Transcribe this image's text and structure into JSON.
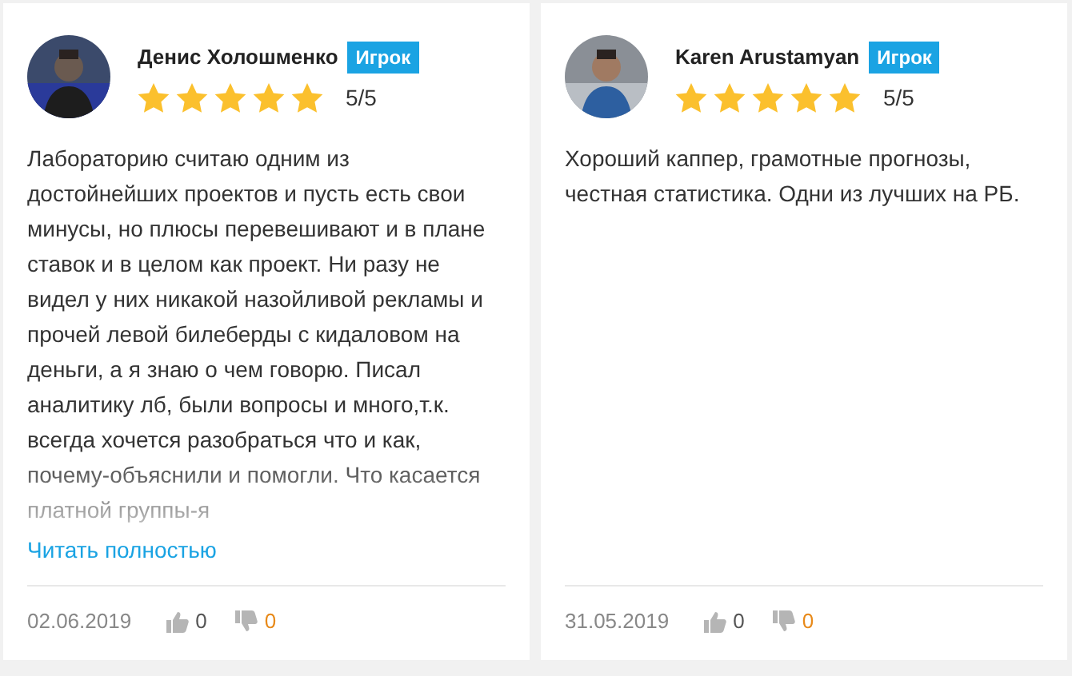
{
  "reviews": [
    {
      "author": "Денис Холошменко",
      "badge": "Игрок",
      "stars": 5,
      "score": "5/5",
      "text": "Лабораторию считаю одним из достойнейших проектов и пусть есть свои минусы, но плюсы перевешивают и в плане ставок и в целом как проект. Ни разу не видел у них никакой назойливой рекламы и прочей левой билеберды с кидаловом на деньги, а я знаю о чем говорю. Писал аналитику лб, были вопросы и много,т.к. всегда хочется разобраться что и как, почему-объяснили и помогли. Что касается платной группы-я",
      "read_more": "Читать полностью",
      "date": "02.06.2019",
      "likes": "0",
      "dislikes": "0"
    },
    {
      "author": "Karen Arustamyan",
      "badge": "Игрок",
      "stars": 5,
      "score": "5/5",
      "text": "Хороший каппер, грамотные прогнозы, честная статистика. Одни из лучших на РБ.",
      "date": "31.05.2019",
      "likes": "0",
      "dislikes": "0"
    }
  ]
}
